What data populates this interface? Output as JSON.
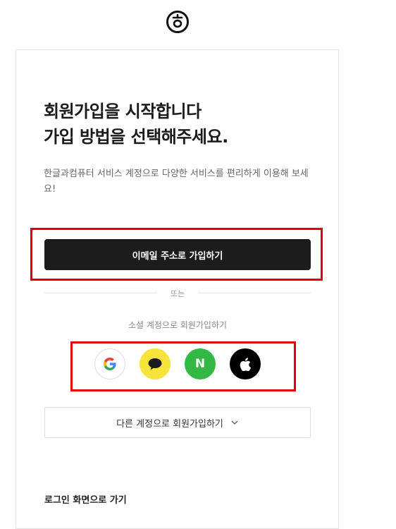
{
  "header": {
    "logo_icon": "hancom-logo-icon"
  },
  "signup": {
    "title_line1": "회원가입을 시작합니다",
    "title_line2": "가입 방법을 선택해주세요.",
    "description": "한글과컴퓨터 서비스 계정으로 다양한 서비스를 편리하게 이용해 보세요!",
    "email_button": "이메일 주소로 가입하기",
    "divider_text": "또는",
    "social_label": "소셜 계정으로 회원가입하기",
    "social_buttons": [
      {
        "name": "Google",
        "icon": "google-icon",
        "color": "#ffffff"
      },
      {
        "name": "Kakao",
        "icon": "kakao-icon",
        "color": "#f7e43a"
      },
      {
        "name": "Naver",
        "icon": "naver-icon",
        "color": "#34b845",
        "glyph": "N"
      },
      {
        "name": "Apple",
        "icon": "apple-icon",
        "color": "#000000"
      }
    ],
    "other_accounts_button": "다른 계정으로 회원가입하기",
    "login_link": "로그인 화면으로 가기"
  },
  "colors": {
    "primary_button": "#1c1c1c",
    "highlight_box": "#e00000"
  }
}
